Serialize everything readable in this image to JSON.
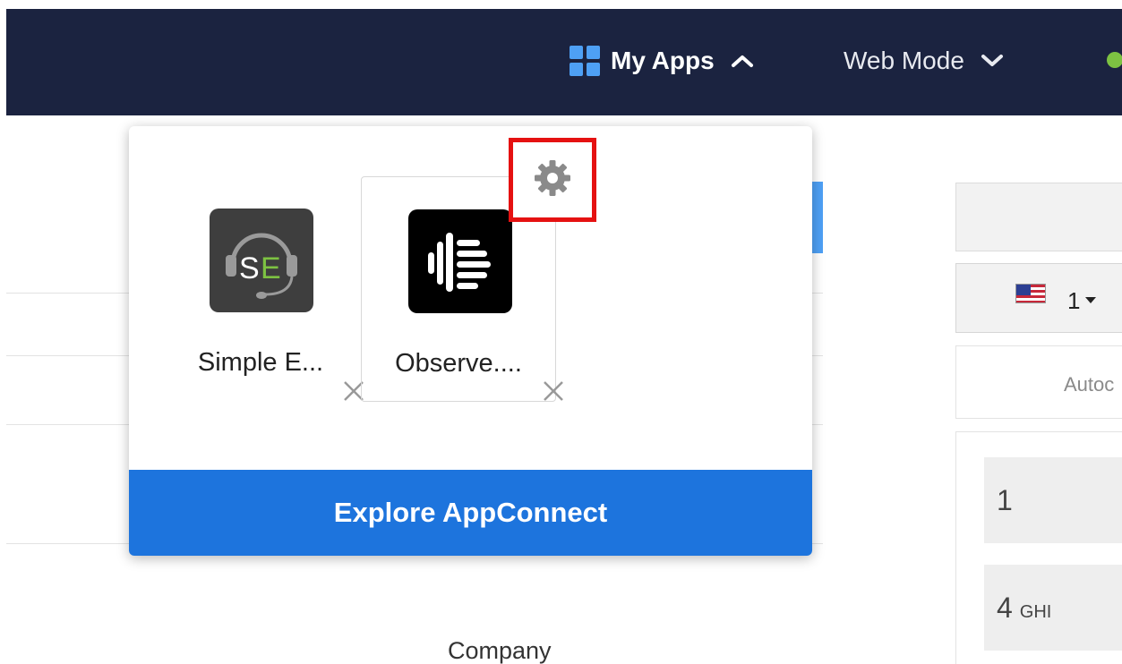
{
  "navbar": {
    "my_apps_label": "My Apps",
    "web_mode_label": "Web Mode",
    "colors": {
      "background": "#1b2340",
      "accent": "#4ea0f5",
      "status": "#7dc242"
    }
  },
  "apps_dropdown": {
    "apps": [
      {
        "name": "Simple E...",
        "icon_text": "SE",
        "icon": "headset-se-icon"
      },
      {
        "name": "Observe....",
        "icon": "observe-ai-icon"
      }
    ],
    "explore_label": "Explore AppConnect",
    "colors": {
      "explore_button": "#1d74dd",
      "highlight": "#e51111"
    }
  },
  "background_page": {
    "company_label": "Company",
    "country_code": "1",
    "autocomplete_text": "Autoc",
    "keypad": [
      {
        "number": "1",
        "letters": ""
      },
      {
        "number": "4",
        "letters": "GHI"
      }
    ]
  }
}
